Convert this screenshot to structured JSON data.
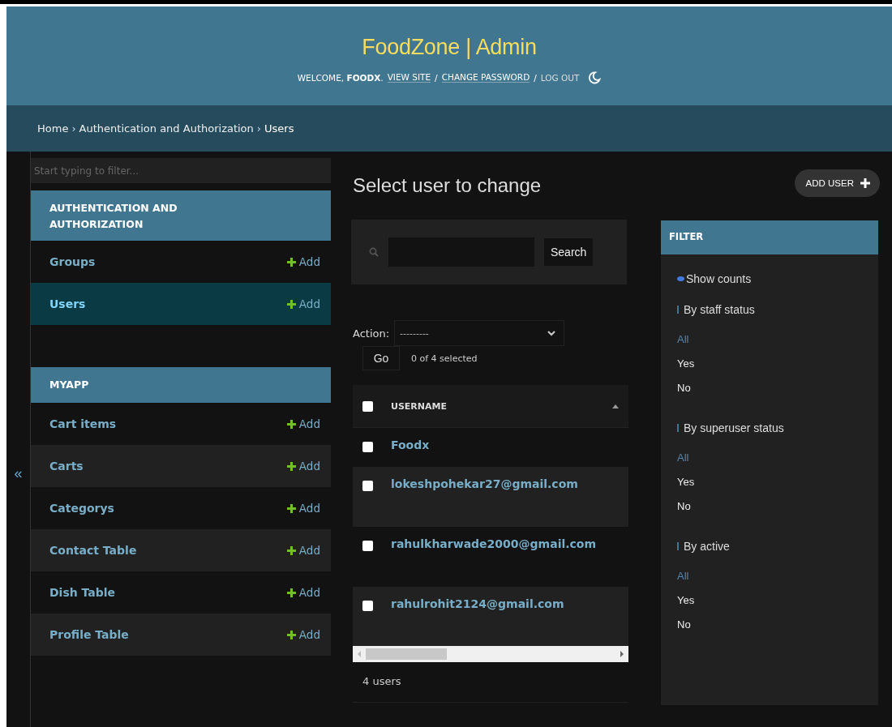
{
  "header": {
    "title": "FoodZone | Admin",
    "user_tools": [
      {
        "kind": "text",
        "text": "WELCOME, **FOODX**."
      },
      {
        "kind": "link",
        "text": "VIEW SITE"
      },
      {
        "kind": "sep",
        "text": "/"
      },
      {
        "kind": "link",
        "text": "CHANGE PASSWORD"
      },
      {
        "kind": "sep",
        "text": "/"
      },
      {
        "kind": "plain-link",
        "text": "LOG OUT"
      },
      {
        "kind": "theme-toggle"
      }
    ]
  },
  "breadcrumbs": {
    "separator": "›",
    "items": [
      "Home",
      "Authentication and Authorization",
      "Users"
    ]
  },
  "sidebar": {
    "filter_placeholder": "Start typing to filter...",
    "collapse_toggle": "«",
    "apps": [
      {
        "name": "AUTHENTICATION AND AUTHORIZATION",
        "models": [
          {
            "name": "Groups",
            "add": "Add",
            "selected": false
          },
          {
            "name": "Users",
            "add": "Add",
            "selected": true
          }
        ]
      },
      {
        "name": "MYAPP",
        "models": [
          {
            "name": "Cart items",
            "add": "Add",
            "selected": false
          },
          {
            "name": "Carts",
            "add": "Add",
            "selected": false
          },
          {
            "name": "Categorys",
            "add": "Add",
            "selected": false
          },
          {
            "name": "Contact Table",
            "add": "Add",
            "selected": false
          },
          {
            "name": "Dish Table",
            "add": "Add",
            "selected": false
          },
          {
            "name": "Profile Table",
            "add": "Add",
            "selected": false
          }
        ]
      }
    ]
  },
  "main": {
    "title": "Select user to change",
    "add_button": "ADD USER",
    "search": {
      "button": "Search"
    },
    "actions": {
      "label": "Action:",
      "select_value": "---------",
      "go": "Go",
      "counter": "0 of 4 selected"
    },
    "table": {
      "all_checked": false,
      "columns": [
        {
          "label": "USERNAME",
          "sorted": true,
          "ascending": true
        }
      ],
      "rows": [
        {
          "username": "Foodx",
          "checked": false
        },
        {
          "username": "lokeshpohekar27@gmail.com",
          "checked": false
        },
        {
          "username": "rahulkharwade2000@gmail.com",
          "checked": false
        },
        {
          "username": "rahulrohit2124@gmail.com",
          "checked": false
        }
      ]
    },
    "paginator": "4 users"
  },
  "filter": {
    "title": "FILTER",
    "show_counts": "Show counts",
    "groups": [
      {
        "title": "By staff status",
        "options": [
          {
            "label": "All",
            "selected": true
          },
          {
            "label": "Yes",
            "selected": false
          },
          {
            "label": "No",
            "selected": false
          }
        ]
      },
      {
        "title": "By superuser status",
        "options": [
          {
            "label": "All",
            "selected": true
          },
          {
            "label": "Yes",
            "selected": false
          },
          {
            "label": "No",
            "selected": false
          }
        ]
      },
      {
        "title": "By active",
        "options": [
          {
            "label": "All",
            "selected": true
          },
          {
            "label": "Yes",
            "selected": false
          },
          {
            "label": "No",
            "selected": false
          }
        ]
      }
    ]
  }
}
